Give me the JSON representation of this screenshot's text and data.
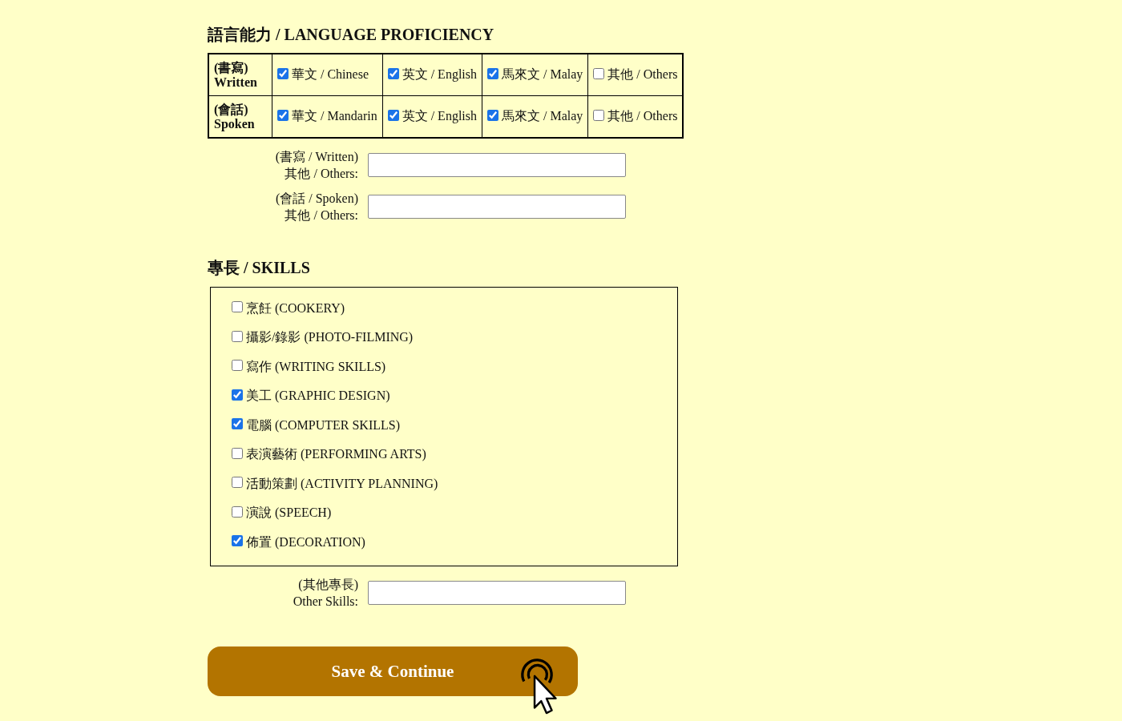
{
  "language_proficiency": {
    "title": "語言能力 / LANGUAGE PROFICIENCY",
    "rows": [
      {
        "label_line_1": "(書寫)",
        "label_line_2": "Written",
        "options": [
          {
            "label": "華文 / Chinese",
            "checked": true
          },
          {
            "label": "英文 / English",
            "checked": true
          },
          {
            "label": "馬來文 / Malay",
            "checked": true
          },
          {
            "label": "其他 / Others",
            "checked": false
          }
        ]
      },
      {
        "label_line_1": "(會話)",
        "label_line_2": "Spoken",
        "options": [
          {
            "label": "華文 / Mandarin",
            "checked": true
          },
          {
            "label": "英文 / English",
            "checked": true
          },
          {
            "label": "馬來文 / Malay",
            "checked": true
          },
          {
            "label": "其他 / Others",
            "checked": false
          }
        ]
      }
    ]
  },
  "other_language_fields": [
    {
      "label_line_1": "(書寫 / Written)",
      "label_line_2": "其他 / Others:"
    },
    {
      "label_line_1": "(會話 / Spoken)",
      "label_line_2": "其他 / Others:"
    }
  ],
  "skills": {
    "title": "專長 / SKILLS",
    "items": [
      {
        "label": "烹飪 (COOKERY)",
        "checked": false
      },
      {
        "label": "攝影/錄影 (PHOTO-FILMING)",
        "checked": false
      },
      {
        "label": "寫作 (WRITING SKILLS)",
        "checked": false
      },
      {
        "label": "美工 (GRAPHIC DESIGN)",
        "checked": true
      },
      {
        "label": "電腦 (COMPUTER SKILLS)",
        "checked": true
      },
      {
        "label": "表演藝術 (PERFORMING ARTS)",
        "checked": false
      },
      {
        "label": "活動策劃 (ACTIVITY PLANNING)",
        "checked": false
      },
      {
        "label": "演說 (SPEECH)",
        "checked": false
      },
      {
        "label": "佈置 (DECORATION)",
        "checked": true
      }
    ]
  },
  "other_skills_field": {
    "label_line_1": "(其他專長)",
    "label_line_2": "Other Skills:"
  },
  "submit_button": {
    "label": "Save & Continue"
  }
}
